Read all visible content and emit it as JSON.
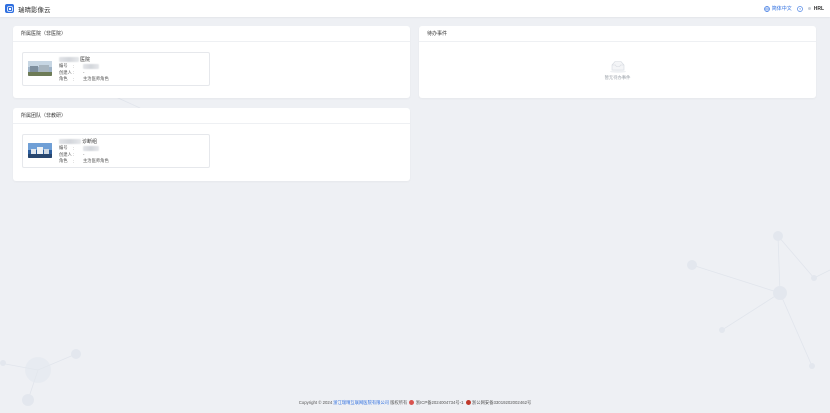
{
  "app": {
    "title": "瑞晴影像云"
  },
  "header": {
    "language_label": "简体中文",
    "help_icon": "help-circle-icon",
    "user_name": "HRL"
  },
  "hospital_card": {
    "title": "所属医院（非医院）",
    "item": {
      "name_suffix": "医院",
      "rows": [
        {
          "key": "编号",
          "colon": ":",
          "value": ""
        },
        {
          "key": "创建人",
          "colon": ":",
          "value": "-"
        },
        {
          "key": "角色",
          "colon": ":",
          "value": "主治医师角色"
        }
      ]
    }
  },
  "team_card": {
    "title": "所属团队（非教研）",
    "item": {
      "name_suffix": "诊断组",
      "rows": [
        {
          "key": "编号",
          "colon": ":",
          "value": ""
        },
        {
          "key": "创建人",
          "colon": ":",
          "value": "-"
        },
        {
          "key": "角色",
          "colon": ":",
          "value": "主治医师角色"
        }
      ]
    }
  },
  "todo_card": {
    "title": "待办事件",
    "empty_text": "暂无待办事件"
  },
  "footer": {
    "copyright": "Copyright © 2024",
    "company": "浙江瑞晴互联网医院有限公司",
    "rights": "版权所有",
    "icp": "浙ICP备2024004734号-1",
    "police": "浙公网安备33019202002462号"
  },
  "colors": {
    "accent": "#2f6fe0",
    "background": "#eef0f4",
    "card": "#ffffff"
  }
}
